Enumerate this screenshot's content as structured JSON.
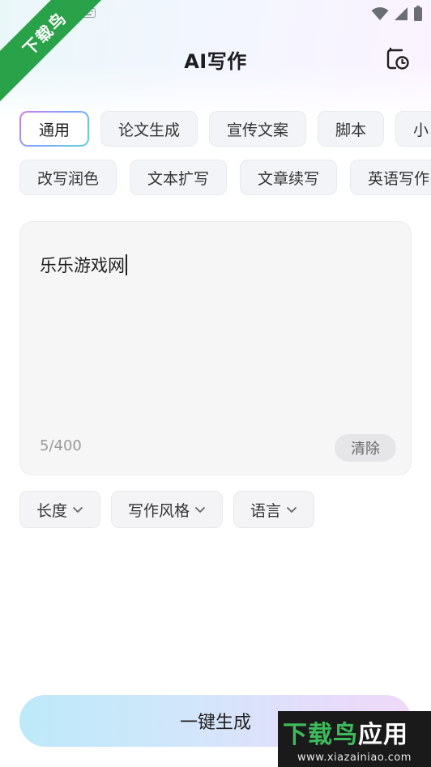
{
  "header": {
    "title": "AI写作"
  },
  "categories": {
    "row1": [
      "通用",
      "论文生成",
      "宣传文案",
      "脚本",
      "小"
    ],
    "row2": [
      "改写润色",
      "文本扩写",
      "文章续写",
      "英语写作"
    ]
  },
  "editor": {
    "text": "乐乐游戏网",
    "char_count": "5/400",
    "clear_label": "清除"
  },
  "options": [
    {
      "label": "长度"
    },
    {
      "label": "写作风格"
    },
    {
      "label": "语言"
    }
  ],
  "generate_label": "一键生成",
  "watermark": {
    "corner_text": "下载鸟",
    "bottom_title_a": "下载鸟",
    "bottom_title_b": "应用",
    "bottom_url": "www.xiazainiao.com"
  },
  "colors": {
    "watermark_green": "#2aa24a",
    "text_primary": "#1d1d1f"
  }
}
